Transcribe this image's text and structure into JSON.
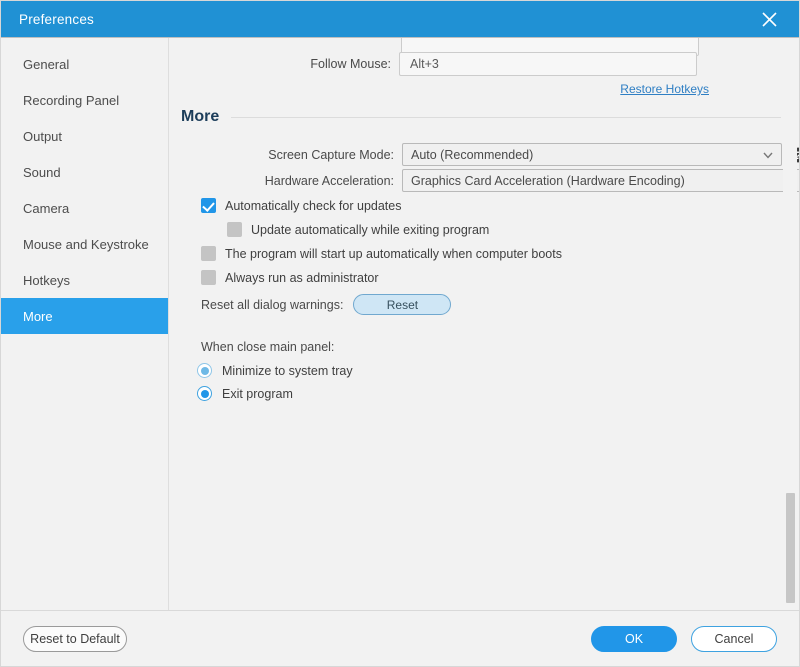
{
  "window": {
    "title": "Preferences",
    "close_icon": "close-icon"
  },
  "colors": {
    "titlebar": "#2091d4",
    "accent": "#2196e8",
    "sidebar_selected": "#29a0ea",
    "section_title": "#1c3d5a",
    "link": "#2f7fc4"
  },
  "sidebar": {
    "items": [
      {
        "label": "General",
        "selected": false
      },
      {
        "label": "Recording Panel",
        "selected": false
      },
      {
        "label": "Output",
        "selected": false
      },
      {
        "label": "Sound",
        "selected": false
      },
      {
        "label": "Camera",
        "selected": false
      },
      {
        "label": "Mouse and Keystroke",
        "selected": false
      },
      {
        "label": "Hotkeys",
        "selected": false
      },
      {
        "label": "More",
        "selected": true
      }
    ]
  },
  "hotkeys": {
    "follow_mouse_label": "Follow Mouse:",
    "follow_mouse_value": "Alt+3",
    "restore_link": "Restore Hotkeys"
  },
  "more": {
    "section_title": "More",
    "screen_capture_mode": {
      "label": "Screen Capture Mode:",
      "value": "Auto (Recommended)",
      "chevron_icon": "chevron-down-icon",
      "help_icon": "help-circle-icon"
    },
    "hardware_acceleration": {
      "label": "Hardware Acceleration:",
      "value": "Graphics Card Acceleration (Hardware Encoding)",
      "chevron_icon": "chevron-down-icon"
    },
    "checkboxes": [
      {
        "label": "Automatically check for updates",
        "checked": true,
        "indent": false
      },
      {
        "label": "Update automatically while exiting program",
        "checked": false,
        "indent": true
      },
      {
        "label": "The program will start up automatically when computer boots",
        "checked": false,
        "indent": false
      },
      {
        "label": "Always run as administrator",
        "checked": false,
        "indent": false
      }
    ],
    "reset_warnings": {
      "label": "Reset all dialog warnings:",
      "button": "Reset"
    },
    "close_panel": {
      "title": "When close main panel:",
      "options": [
        {
          "label": "Minimize to system tray",
          "selected": false
        },
        {
          "label": "Exit program",
          "selected": true
        }
      ]
    }
  },
  "footer": {
    "reset_to_default": "Reset to Default",
    "ok": "OK",
    "cancel": "Cancel"
  }
}
